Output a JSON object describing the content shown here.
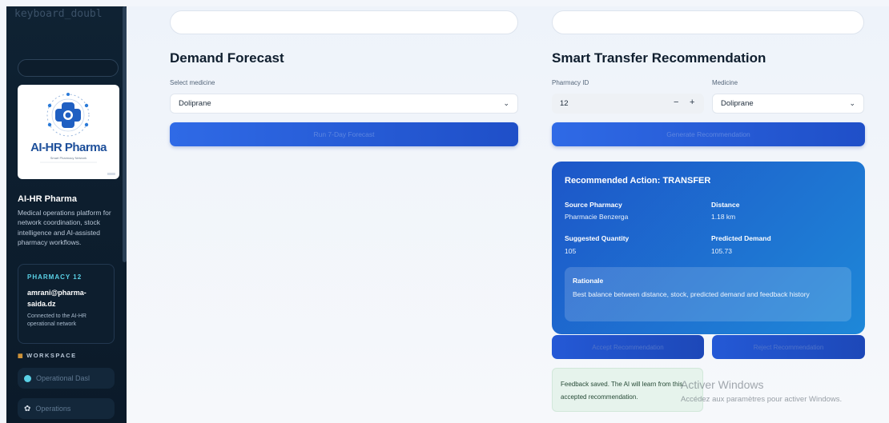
{
  "sidebar": {
    "faded_text": "keyboard_doubl",
    "brand_title": "AI-HR Pharma",
    "brand_description": "Medical operations platform for network coordination, stock intelligence and AI-assisted pharmacy workflows.",
    "logo": {
      "title": "AI-HR Pharma",
      "subtitle": "Smart Pharmacy Network"
    },
    "pharmacy_card": {
      "tag": "PHARMACY 12",
      "email": "amrani@pharma-saida.dz",
      "note": "Connected to the AI-HR operational network"
    },
    "workspace_label": "WORKSPACE",
    "nav": [
      {
        "label": "Operational Dasl",
        "icon": "circle-dot-icon"
      },
      {
        "label": "Operations",
        "icon": "gear-icon"
      }
    ]
  },
  "forecast": {
    "title": "Demand Forecast",
    "select_label": "Select medicine",
    "select_value": "Doliprane",
    "button_label": "Run 7-Day Forecast"
  },
  "transfer": {
    "title": "Smart Transfer Recommendation",
    "pharmacy_label": "Pharmacy ID",
    "pharmacy_value": "12",
    "medicine_label": "Medicine",
    "medicine_value": "Doliprane",
    "button_label": "Generate Recommendation",
    "stepper_minus": "−",
    "stepper_plus": "+"
  },
  "recommendation": {
    "title": "Recommended Action: TRANSFER",
    "source_label": "Source Pharmacy",
    "source_value": "Pharmacie Benzerga",
    "distance_label": "Distance",
    "distance_value": "1.18 km",
    "quantity_label": "Suggested Quantity",
    "quantity_value": "105",
    "demand_label": "Predicted Demand",
    "demand_value": "105.73",
    "rationale_title": "Rationale",
    "rationale_text": "Best balance between distance, stock, predicted demand and feedback history"
  },
  "actions": {
    "accept_label": "Accept Recommendation",
    "reject_label": "Reject Recommendation"
  },
  "feedback": {
    "text": "Feedback saved. The AI will learn from this accepted recommendation."
  },
  "watermark": {
    "title": "Activer Windows",
    "subtitle": "Accédez aux paramètres pour activer Windows."
  }
}
